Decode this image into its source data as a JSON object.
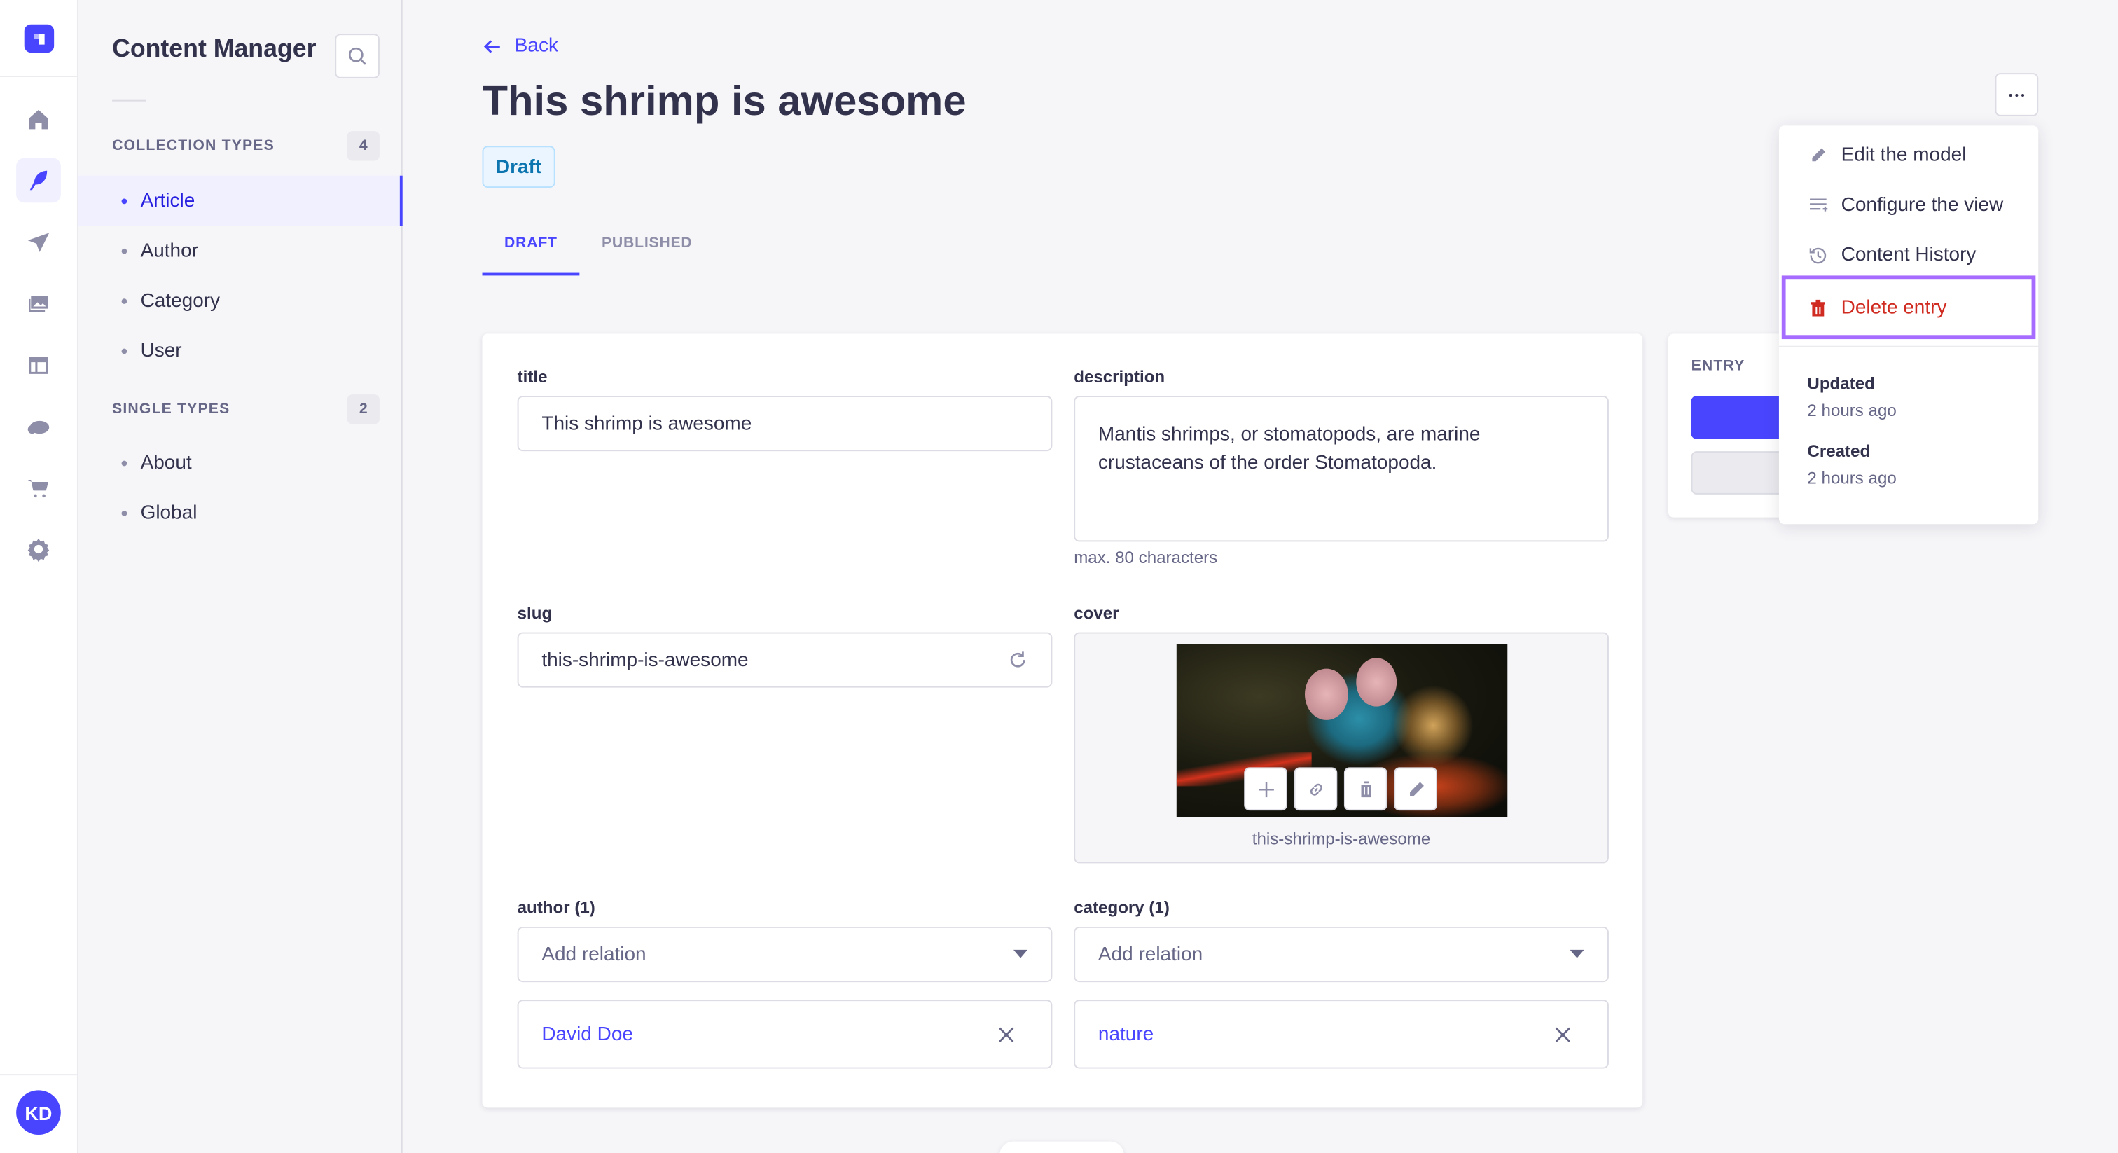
{
  "nav": {
    "avatar": "KD",
    "icons": [
      "strapi-logo",
      "home-icon",
      "content-manager-feather-icon",
      "paper-plane-icon",
      "media-library-icon",
      "layout-icon",
      "cloud-icon",
      "cart-icon",
      "gear-icon"
    ],
    "active": "content-manager-feather-icon"
  },
  "sidebar": {
    "title": "Content Manager",
    "collection_types": {
      "label": "COLLECTION TYPES",
      "count": "4",
      "items": [
        {
          "label": "Article",
          "active": true
        },
        {
          "label": "Author"
        },
        {
          "label": "Category"
        },
        {
          "label": "User"
        }
      ]
    },
    "single_types": {
      "label": "SINGLE TYPES",
      "count": "2",
      "items": [
        {
          "label": "About"
        },
        {
          "label": "Global"
        }
      ]
    }
  },
  "header": {
    "back": "Back",
    "title": "This shrimp is awesome",
    "status": "Draft",
    "tabs": [
      {
        "label": "DRAFT",
        "active": true
      },
      {
        "label": "PUBLISHED"
      }
    ]
  },
  "form": {
    "title": {
      "label": "title",
      "value": "This shrimp is awesome"
    },
    "description": {
      "label": "description",
      "value": "Mantis shrimps, or stomatopods, are marine crustaceans of the order Stomatopoda.",
      "hint": "max. 80 characters"
    },
    "slug": {
      "label": "slug",
      "value": "this-shrimp-is-awesome"
    },
    "cover": {
      "label": "cover",
      "caption": "this-shrimp-is-awesome"
    },
    "author": {
      "label": "author (1)",
      "placeholder": "Add relation",
      "items": [
        "David Doe"
      ]
    },
    "category": {
      "label": "category (1)",
      "placeholder": "Add relation",
      "items": [
        "nature"
      ]
    }
  },
  "entry_panel": {
    "label": "ENTRY"
  },
  "menu": {
    "items": [
      {
        "label": "Edit the model",
        "icon": "pencil-icon"
      },
      {
        "label": "Configure the view",
        "icon": "list-settings-icon"
      },
      {
        "label": "Content History",
        "icon": "history-icon"
      },
      {
        "label": "Delete entry",
        "icon": "trash-icon",
        "danger": true
      }
    ],
    "updated_label": "Updated",
    "updated_value": "2 hours ago",
    "created_label": "Created",
    "created_value": "2 hours ago"
  },
  "colors": {
    "primary": "#4945ff",
    "danger": "#d02b20",
    "highlight": "#a66cff"
  }
}
